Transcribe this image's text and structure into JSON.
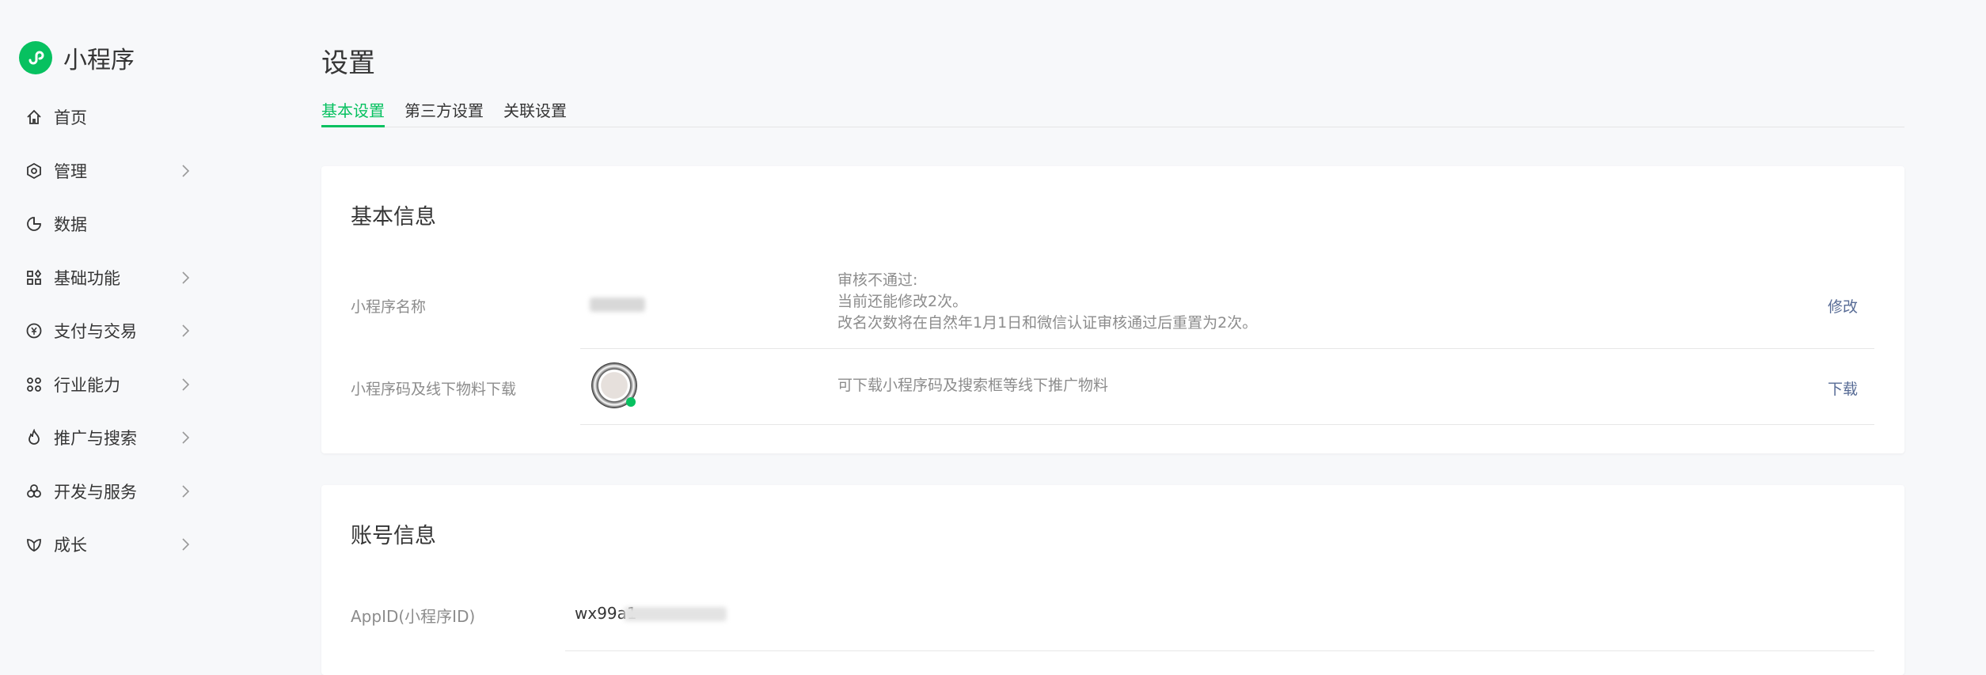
{
  "app": {
    "name": "小程序",
    "brand_color": "#07c160"
  },
  "sidebar": {
    "items": [
      {
        "label": "首页",
        "icon": "home-icon",
        "chevron": false
      },
      {
        "label": "管理",
        "icon": "hexagon-settings-icon",
        "chevron": true
      },
      {
        "label": "数据",
        "icon": "pie-chart-icon",
        "chevron": false
      },
      {
        "label": "基础功能",
        "icon": "grid-icon",
        "chevron": true
      },
      {
        "label": "支付与交易",
        "icon": "yen-icon",
        "chevron": true
      },
      {
        "label": "行业能力",
        "icon": "nodes-icon",
        "chevron": true
      },
      {
        "label": "推广与搜索",
        "icon": "flame-icon",
        "chevron": true
      },
      {
        "label": "开发与服务",
        "icon": "cluster-icon",
        "chevron": true
      },
      {
        "label": "成长",
        "icon": "leaf-icon",
        "chevron": true
      }
    ]
  },
  "page": {
    "title": "设置",
    "tabs": [
      {
        "label": "基本设置",
        "active": true
      },
      {
        "label": "第三方设置"
      },
      {
        "label": "关联设置"
      }
    ]
  },
  "basic_info": {
    "title": "基本信息",
    "rows": [
      {
        "label": "小程序名称",
        "desc": [
          "审核不通过:",
          "当前还能修改2次。",
          "改名次数将在自然年1月1日和微信认证审核通过后重置为2次。"
        ],
        "action": "修改"
      },
      {
        "label": "小程序码及线下物料下载",
        "desc": [
          "可下载小程序码及搜索框等线下推广物料"
        ],
        "action": "下载"
      }
    ]
  },
  "account_info": {
    "title": "账号信息",
    "appid_label": "AppID(小程序ID)",
    "appid_value": "wx99a1"
  }
}
